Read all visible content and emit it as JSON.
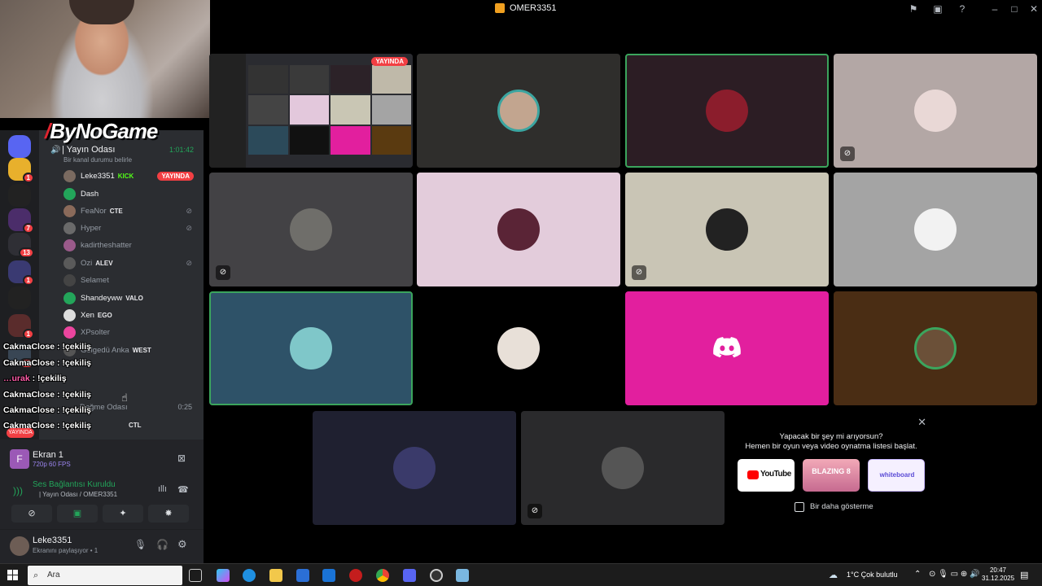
{
  "window": {
    "title": "OMER3351"
  },
  "logo": {
    "text": "ByNoGame"
  },
  "servers": {
    "badges": [
      "1",
      "7",
      "13",
      "1",
      "1",
      "11"
    ]
  },
  "voice": {
    "channel_name": "| Yayın Odası",
    "elapsed": "1:01:42",
    "status_placeholder": "Bir kanal durumu belirle",
    "users": [
      {
        "name": "Leke3351",
        "tag": "KICK",
        "live": "YAYINDA"
      },
      {
        "name": "Dash",
        "tag": ""
      },
      {
        "name": "FeaNor",
        "tag": "CTE"
      },
      {
        "name": "Hyper",
        "tag": ""
      },
      {
        "name": "kadirtheshatter",
        "tag": ""
      },
      {
        "name": "Ozi",
        "tag": "ALEV"
      },
      {
        "name": "Selamet",
        "tag": ""
      },
      {
        "name": "Shandeyww",
        "tag": "VALO"
      },
      {
        "name": "Xen",
        "tag": "EGO"
      },
      {
        "name": "XPsolter",
        "tag": ""
      },
      {
        "name": "Gölgedü Anka",
        "tag": "WEST"
      }
    ],
    "other_channel": "Değme Odası",
    "other_time": "0:25",
    "ctl_tag": "CTL"
  },
  "chat": [
    {
      "user": "CakmaClose",
      "msg": "!çekiliş"
    },
    {
      "user": "CakmaClose",
      "msg": "!çekiliş"
    },
    {
      "user": "…urak",
      "msg": "!çekiliş"
    },
    {
      "user": "CakmaClose",
      "msg": "!çekiliş"
    },
    {
      "user": "CakmaClose",
      "msg": "!çekiliş"
    },
    {
      "user": "CakmaClose",
      "msg": "!çekiliş"
    }
  ],
  "screen_share": {
    "title": "Ekran 1",
    "quality": "720p 60 FPS"
  },
  "voice_conn": {
    "title": "Ses Bağlantısı Kuruldu",
    "sub": "| Yayın Odası / OMER3351"
  },
  "user": {
    "name": "Leke3351",
    "status": "Ekranını paylaşıyor • 1"
  },
  "live_badge": "YAYINDA",
  "activity": {
    "line1": "Yapacak bir şey mi arıyorsun?",
    "line2": "Hemen bir oyun veya video oynatma listesi başlat.",
    "cards": [
      "YouTube",
      "BLAZING 8",
      "whiteboard"
    ],
    "dont_show": "Bir daha gösterme"
  },
  "taskbar": {
    "search": "Ara",
    "weather": "1°C  Çok bulutlu",
    "time": "20:47",
    "date": "31.12.2025"
  },
  "colors": {
    "accent": "#5865f2",
    "speaking": "#3ba55d",
    "live": "#f23f43",
    "discord_pink": "#eb459e"
  }
}
